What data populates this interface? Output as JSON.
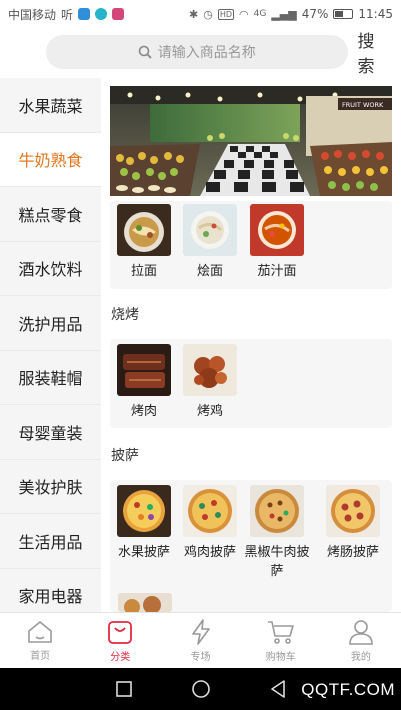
{
  "status_bar": {
    "carrier": "中国移动",
    "carrier_suffix": "听",
    "network": "4G",
    "battery": "47%",
    "battery_level": 0.47,
    "time": "11:45"
  },
  "search": {
    "placeholder": "请输入商品名称",
    "button_label": "搜索"
  },
  "sidebar": {
    "active_index": 1,
    "items": [
      {
        "label": "水果蔬菜"
      },
      {
        "label": "牛奶熟食"
      },
      {
        "label": "糕点零食"
      },
      {
        "label": "酒水饮料"
      },
      {
        "label": "洗护用品"
      },
      {
        "label": "服装鞋帽"
      },
      {
        "label": "母婴童装"
      },
      {
        "label": "美妆护肤"
      },
      {
        "label": "生活用品"
      },
      {
        "label": "家用电器"
      }
    ]
  },
  "banner": {
    "sign_text": "FRUIT WORK"
  },
  "sections": {
    "noodles": {
      "items": [
        "拉面",
        "烩面",
        "茄汁面"
      ]
    },
    "bbq": {
      "title": "烧烤",
      "items": [
        "烤肉",
        "烤鸡"
      ]
    },
    "pizza": {
      "title": "披萨",
      "items": [
        "水果披萨",
        "鸡肉披萨",
        "黑椒牛肉披萨",
        "烤肠披萨"
      ]
    }
  },
  "tabbar": {
    "active_index": 1,
    "items": [
      {
        "label": "首页",
        "icon": "home-icon"
      },
      {
        "label": "分类",
        "icon": "category-bag-icon"
      },
      {
        "label": "专场",
        "icon": "lightning-icon"
      },
      {
        "label": "购物车",
        "icon": "cart-icon"
      },
      {
        "label": "我的",
        "icon": "user-icon"
      }
    ]
  },
  "watermark": "QQTF.COM",
  "colors": {
    "accent": "#e3761f",
    "tab_active": "#e02a3f"
  }
}
